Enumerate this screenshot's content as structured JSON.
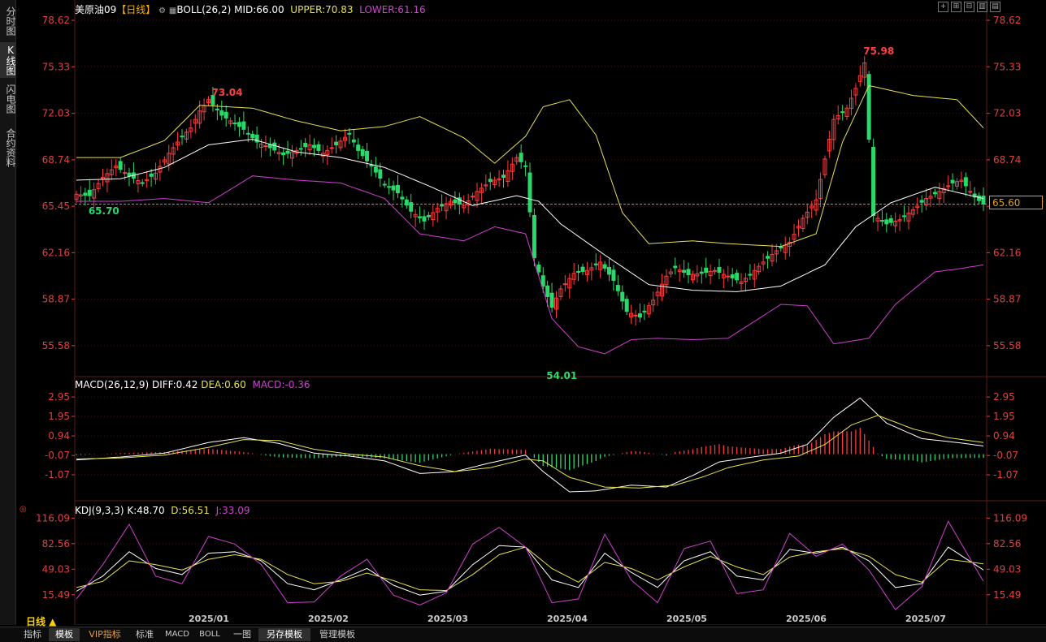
{
  "nav": {
    "tabs": [
      {
        "label": "分时图",
        "active": false
      },
      {
        "label": "K线图",
        "active": true
      },
      {
        "label": "闪电图",
        "active": false
      },
      {
        "label": "合约资料",
        "active": false
      }
    ]
  },
  "header": {
    "symbol": "美原油09",
    "period_tag": "【日线】",
    "boll_label": "BOLL(26,2)",
    "mid": "MID:66.00",
    "upper": "UPPER:70.83",
    "lower": "LOWER:61.16"
  },
  "macd_header": {
    "label": "MACD(26,12,9)",
    "diff": "DIFF:0.42",
    "dea": "DEA:0.60",
    "macd": "MACD:-0.36"
  },
  "kdj_header": {
    "label": "KDJ(9,3,3)",
    "k": "K:48.70",
    "d": "D:56.51",
    "j": "J:33.09"
  },
  "period_label": "日线 ▲",
  "current_price": "65.60",
  "toolbar_icons": [
    "crosshair-icon",
    "zoom-in-icon",
    "zoom-out-icon",
    "layout-icon",
    "expand-icon"
  ],
  "bottom_tabs": [
    {
      "label": "指标",
      "selected": false,
      "vip": false
    },
    {
      "label": "模板",
      "selected": true,
      "vip": false
    },
    {
      "label": "VIP指标",
      "selected": false,
      "vip": true
    },
    {
      "label": "标准",
      "selected": false,
      "vip": false
    },
    {
      "label": "MACD",
      "selected": false,
      "vip": false
    },
    {
      "label": "BOLL",
      "selected": false,
      "vip": false
    },
    {
      "label": "一图",
      "selected": false,
      "vip": false
    },
    {
      "label": "另存模板",
      "selected": true,
      "vip": false
    },
    {
      "label": "管理模板",
      "selected": false,
      "vip": false
    }
  ],
  "colors": {
    "up": "#ff3b3b",
    "down": "#2bd86a",
    "mid": "#ffffff",
    "upper": "#e8e050",
    "lower": "#d040d0",
    "dea": "#e8e050",
    "j": "#d040d0",
    "axis": "#e04040",
    "grid": "#3a1010"
  },
  "chart_data": {
    "type": "candlestick",
    "price_ticks": [
      78.62,
      75.33,
      72.03,
      68.74,
      65.45,
      62.16,
      58.87,
      55.58
    ],
    "price_ylim": [
      53.5,
      79.6
    ],
    "macd_ticks": [
      2.95,
      1.95,
      0.94,
      -0.07,
      -1.07
    ],
    "macd_ylim": [
      -2.2,
      3.5
    ],
    "kdj_ticks": [
      116.09,
      82.56,
      49.03,
      15.49
    ],
    "kdj_ylim": [
      -5,
      125
    ],
    "x_labels": [
      "2025/01",
      "2025/02",
      "2025/03",
      "2025/04",
      "2025/05",
      "2025/06",
      "2025/07"
    ],
    "annotations": [
      {
        "text": "73.04",
        "kind": "high"
      },
      {
        "text": "75.98",
        "kind": "high"
      },
      {
        "text": "65.70",
        "kind": "low"
      },
      {
        "text": "54.01",
        "kind": "low"
      }
    ],
    "price_path": [
      [
        0,
        66.3
      ],
      [
        3,
        66.2
      ],
      [
        6,
        67.5
      ],
      [
        9,
        68.3
      ],
      [
        12,
        67.6
      ],
      [
        15,
        67.1
      ],
      [
        18,
        67.8
      ],
      [
        21,
        69.2
      ],
      [
        24,
        70.4
      ],
      [
        26,
        71.0
      ],
      [
        28,
        72.2
      ],
      [
        30,
        73.0
      ],
      [
        33,
        71.9
      ],
      [
        35,
        71.5
      ],
      [
        38,
        70.9
      ],
      [
        41,
        70.0
      ],
      [
        44,
        69.6
      ],
      [
        47,
        69.1
      ],
      [
        50,
        69.4
      ],
      [
        53,
        69.8
      ],
      [
        56,
        69.2
      ],
      [
        59,
        69.8
      ],
      [
        62,
        70.6
      ],
      [
        64,
        69.4
      ],
      [
        67,
        68.3
      ],
      [
        70,
        67.0
      ],
      [
        73,
        66.4
      ],
      [
        76,
        65.1
      ],
      [
        79,
        64.4
      ],
      [
        82,
        65.3
      ],
      [
        85,
        65.8
      ],
      [
        88,
        65.5
      ],
      [
        91,
        66.5
      ],
      [
        94,
        67.2
      ],
      [
        97,
        67.5
      ],
      [
        100,
        68.9
      ],
      [
        102,
        68.3
      ],
      [
        104,
        61.8
      ],
      [
        106,
        59.8
      ],
      [
        108,
        58.3
      ],
      [
        110,
        59.6
      ],
      [
        113,
        60.7
      ],
      [
        116,
        60.9
      ],
      [
        119,
        61.5
      ],
      [
        122,
        60.2
      ],
      [
        125,
        58.0
      ],
      [
        128,
        57.6
      ],
      [
        131,
        58.8
      ],
      [
        134,
        60.5
      ],
      [
        136,
        61.1
      ],
      [
        139,
        60.6
      ],
      [
        142,
        60.7
      ],
      [
        145,
        60.9
      ],
      [
        148,
        60.5
      ],
      [
        151,
        60.1
      ],
      [
        153,
        60.6
      ],
      [
        156,
        61.5
      ],
      [
        159,
        62.3
      ],
      [
        162,
        62.9
      ],
      [
        165,
        64.6
      ],
      [
        168,
        65.9
      ],
      [
        170,
        68.8
      ],
      [
        172,
        71.6
      ],
      [
        175,
        72.4
      ],
      [
        177,
        73.8
      ],
      [
        179,
        75.6
      ],
      [
        181,
        64.8
      ],
      [
        184,
        64.2
      ],
      [
        187,
        64.5
      ],
      [
        190,
        65.2
      ],
      [
        193,
        66.0
      ],
      [
        196,
        66.5
      ],
      [
        199,
        67.1
      ],
      [
        201,
        67.3
      ],
      [
        204,
        66.1
      ],
      [
        206,
        65.6
      ]
    ],
    "mid_path": [
      [
        0,
        67.3
      ],
      [
        10,
        67.4
      ],
      [
        20,
        68.2
      ],
      [
        30,
        69.8
      ],
      [
        40,
        70.2
      ],
      [
        50,
        69.3
      ],
      [
        60,
        68.9
      ],
      [
        70,
        68.2
      ],
      [
        80,
        66.9
      ],
      [
        90,
        65.5
      ],
      [
        100,
        66.2
      ],
      [
        105,
        65.8
      ],
      [
        110,
        64.2
      ],
      [
        120,
        62.0
      ],
      [
        130,
        59.9
      ],
      [
        140,
        59.5
      ],
      [
        150,
        59.4
      ],
      [
        160,
        59.8
      ],
      [
        170,
        61.3
      ],
      [
        177,
        64.0
      ],
      [
        185,
        65.7
      ],
      [
        195,
        66.8
      ],
      [
        206,
        66.0
      ]
    ],
    "upper_path": [
      [
        0,
        68.9
      ],
      [
        10,
        68.9
      ],
      [
        20,
        70.1
      ],
      [
        28,
        72.6
      ],
      [
        40,
        72.4
      ],
      [
        50,
        71.5
      ],
      [
        60,
        70.8
      ],
      [
        70,
        71.1
      ],
      [
        78,
        71.8
      ],
      [
        88,
        70.3
      ],
      [
        95,
        68.5
      ],
      [
        102,
        70.4
      ],
      [
        106,
        72.5
      ],
      [
        112,
        73.0
      ],
      [
        118,
        70.5
      ],
      [
        124,
        65.0
      ],
      [
        130,
        62.8
      ],
      [
        140,
        63.0
      ],
      [
        148,
        62.8
      ],
      [
        160,
        62.6
      ],
      [
        168,
        63.5
      ],
      [
        174,
        70.0
      ],
      [
        180,
        74.0
      ],
      [
        190,
        73.3
      ],
      [
        200,
        73.0
      ],
      [
        206,
        71.0
      ]
    ],
    "lower_path": [
      [
        0,
        65.8
      ],
      [
        10,
        65.8
      ],
      [
        20,
        66.0
      ],
      [
        30,
        65.7
      ],
      [
        40,
        67.6
      ],
      [
        50,
        67.3
      ],
      [
        60,
        67.1
      ],
      [
        70,
        66.0
      ],
      [
        78,
        63.5
      ],
      [
        88,
        63.0
      ],
      [
        95,
        64.0
      ],
      [
        102,
        63.5
      ],
      [
        108,
        57.5
      ],
      [
        114,
        55.5
      ],
      [
        120,
        55.0
      ],
      [
        126,
        56.0
      ],
      [
        132,
        56.1
      ],
      [
        140,
        56.0
      ],
      [
        148,
        56.1
      ],
      [
        155,
        57.5
      ],
      [
        160,
        58.5
      ],
      [
        166,
        58.4
      ],
      [
        172,
        55.7
      ],
      [
        180,
        56.1
      ],
      [
        186,
        58.5
      ],
      [
        195,
        60.8
      ],
      [
        200,
        61.0
      ],
      [
        206,
        61.3
      ]
    ],
    "diff_path": [
      [
        0,
        -0.3
      ],
      [
        10,
        -0.15
      ],
      [
        20,
        0.05
      ],
      [
        30,
        0.6
      ],
      [
        38,
        0.85
      ],
      [
        46,
        0.55
      ],
      [
        54,
        0.05
      ],
      [
        62,
        -0.1
      ],
      [
        70,
        -0.35
      ],
      [
        78,
        -1.0
      ],
      [
        86,
        -0.9
      ],
      [
        94,
        -0.45
      ],
      [
        102,
        -0.05
      ],
      [
        106,
        -0.9
      ],
      [
        112,
        -1.95
      ],
      [
        118,
        -1.9
      ],
      [
        126,
        -1.6
      ],
      [
        134,
        -1.7
      ],
      [
        140,
        -1.1
      ],
      [
        146,
        -0.4
      ],
      [
        152,
        -0.2
      ],
      [
        160,
        0.05
      ],
      [
        166,
        0.5
      ],
      [
        172,
        1.9
      ],
      [
        178,
        2.9
      ],
      [
        184,
        1.6
      ],
      [
        192,
        0.8
      ],
      [
        200,
        0.6
      ],
      [
        206,
        0.42
      ]
    ],
    "dea_path": [
      [
        0,
        -0.25
      ],
      [
        10,
        -0.2
      ],
      [
        20,
        -0.05
      ],
      [
        30,
        0.35
      ],
      [
        38,
        0.75
      ],
      [
        46,
        0.7
      ],
      [
        54,
        0.25
      ],
      [
        62,
        0.0
      ],
      [
        70,
        -0.15
      ],
      [
        78,
        -0.6
      ],
      [
        86,
        -0.9
      ],
      [
        94,
        -0.7
      ],
      [
        102,
        -0.25
      ],
      [
        106,
        -0.35
      ],
      [
        112,
        -1.2
      ],
      [
        120,
        -1.7
      ],
      [
        128,
        -1.75
      ],
      [
        136,
        -1.6
      ],
      [
        142,
        -1.2
      ],
      [
        148,
        -0.7
      ],
      [
        156,
        -0.3
      ],
      [
        164,
        -0.1
      ],
      [
        170,
        0.5
      ],
      [
        176,
        1.5
      ],
      [
        182,
        2.0
      ],
      [
        190,
        1.3
      ],
      [
        198,
        0.85
      ],
      [
        206,
        0.6
      ]
    ],
    "k_path": [
      [
        0,
        20
      ],
      [
        6,
        40
      ],
      [
        12,
        72
      ],
      [
        18,
        50
      ],
      [
        24,
        42
      ],
      [
        30,
        70
      ],
      [
        36,
        72
      ],
      [
        42,
        60
      ],
      [
        48,
        30
      ],
      [
        54,
        22
      ],
      [
        60,
        35
      ],
      [
        66,
        50
      ],
      [
        72,
        28
      ],
      [
        78,
        15
      ],
      [
        84,
        20
      ],
      [
        90,
        55
      ],
      [
        96,
        80
      ],
      [
        102,
        78
      ],
      [
        108,
        35
      ],
      [
        114,
        25
      ],
      [
        120,
        70
      ],
      [
        126,
        45
      ],
      [
        132,
        25
      ],
      [
        138,
        60
      ],
      [
        144,
        72
      ],
      [
        150,
        40
      ],
      [
        156,
        35
      ],
      [
        162,
        75
      ],
      [
        168,
        70
      ],
      [
        174,
        78
      ],
      [
        180,
        60
      ],
      [
        186,
        25
      ],
      [
        192,
        30
      ],
      [
        198,
        78
      ],
      [
        206,
        48
      ]
    ],
    "d_path": [
      [
        0,
        25
      ],
      [
        6,
        33
      ],
      [
        12,
        60
      ],
      [
        18,
        55
      ],
      [
        24,
        48
      ],
      [
        30,
        62
      ],
      [
        36,
        68
      ],
      [
        42,
        62
      ],
      [
        48,
        42
      ],
      [
        54,
        30
      ],
      [
        60,
        33
      ],
      [
        66,
        44
      ],
      [
        72,
        34
      ],
      [
        78,
        22
      ],
      [
        84,
        21
      ],
      [
        90,
        42
      ],
      [
        96,
        68
      ],
      [
        102,
        78
      ],
      [
        108,
        50
      ],
      [
        114,
        32
      ],
      [
        120,
        58
      ],
      [
        126,
        50
      ],
      [
        132,
        35
      ],
      [
        138,
        52
      ],
      [
        144,
        66
      ],
      [
        150,
        52
      ],
      [
        156,
        42
      ],
      [
        162,
        65
      ],
      [
        168,
        72
      ],
      [
        174,
        76
      ],
      [
        180,
        66
      ],
      [
        186,
        42
      ],
      [
        192,
        32
      ],
      [
        198,
        62
      ],
      [
        206,
        56
      ]
    ],
    "j_path": [
      [
        0,
        10
      ],
      [
        6,
        55
      ],
      [
        12,
        108
      ],
      [
        18,
        40
      ],
      [
        24,
        30
      ],
      [
        30,
        92
      ],
      [
        36,
        82
      ],
      [
        42,
        55
      ],
      [
        48,
        5
      ],
      [
        54,
        6
      ],
      [
        60,
        40
      ],
      [
        66,
        62
      ],
      [
        72,
        15
      ],
      [
        78,
        2
      ],
      [
        84,
        18
      ],
      [
        90,
        82
      ],
      [
        96,
        104
      ],
      [
        102,
        78
      ],
      [
        108,
        5
      ],
      [
        114,
        10
      ],
      [
        120,
        95
      ],
      [
        126,
        35
      ],
      [
        132,
        5
      ],
      [
        138,
        76
      ],
      [
        144,
        86
      ],
      [
        150,
        17
      ],
      [
        156,
        22
      ],
      [
        162,
        96
      ],
      [
        168,
        66
      ],
      [
        174,
        82
      ],
      [
        180,
        48
      ],
      [
        186,
        -4
      ],
      [
        192,
        26
      ],
      [
        198,
        112
      ],
      [
        206,
        33
      ]
    ]
  }
}
